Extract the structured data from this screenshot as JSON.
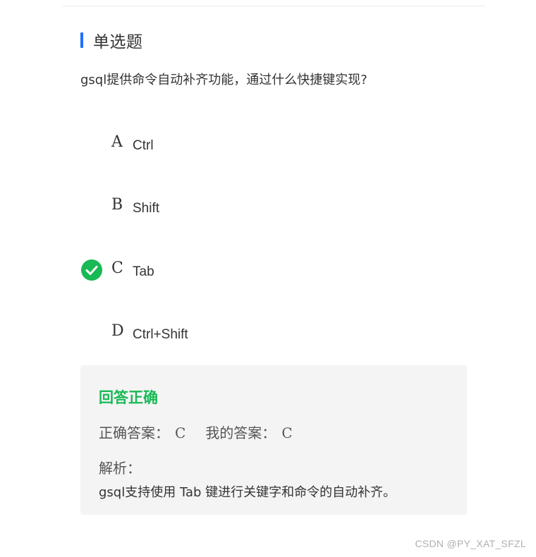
{
  "section": {
    "title": "单选题",
    "accent_color": "#1e6fff"
  },
  "question": {
    "text": "gsql提供命令自动补齐功能，通过什么快捷键实现?"
  },
  "options": [
    {
      "letter": "A",
      "text": "Ctrl",
      "selected": false
    },
    {
      "letter": "B",
      "text": "Shift",
      "selected": false
    },
    {
      "letter": "C",
      "text": "Tab",
      "selected": true
    },
    {
      "letter": "D",
      "text": "Ctrl+Shift",
      "selected": false
    }
  ],
  "result": {
    "status": "回答正确",
    "status_color": "#19b955",
    "correct_answer_label": "正确答案：",
    "correct_answer": "C",
    "my_answer_label": "我的答案：",
    "my_answer": "C",
    "analysis_label": "解析：",
    "analysis_text": "gsql支持使用 Tab 键进行关键字和命令的自动补齐。"
  },
  "watermark": "CSDN @PY_XAT_SFZL"
}
